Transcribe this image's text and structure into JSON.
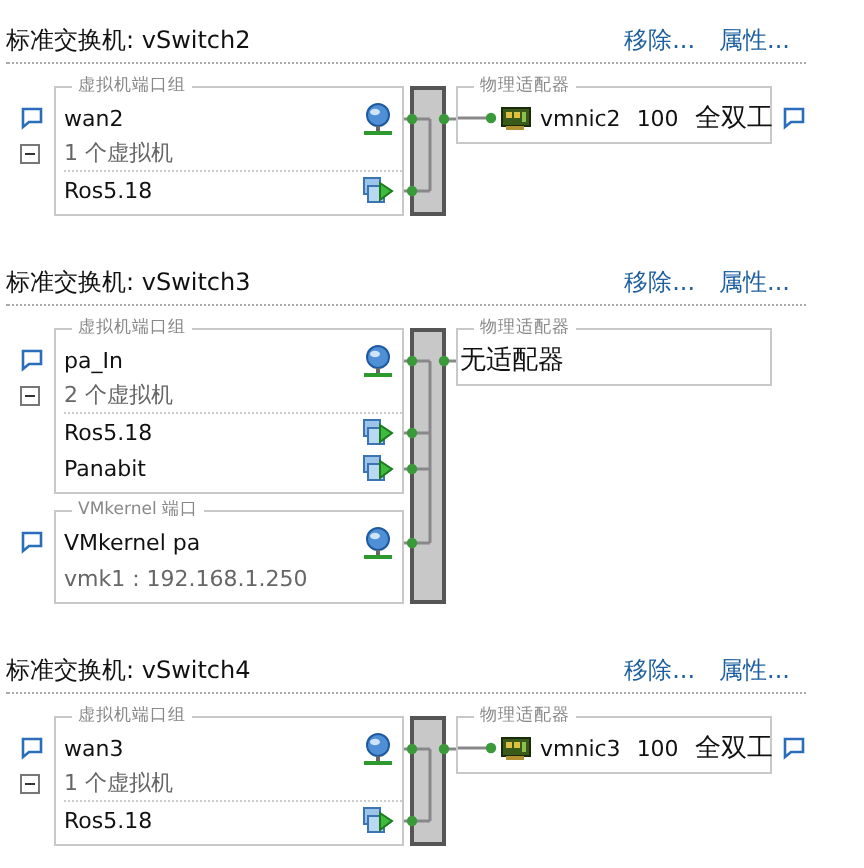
{
  "switches": [
    {
      "title": "标准交换机: vSwitch2",
      "links": [
        "移除...",
        "属性..."
      ],
      "port_groups": [
        {
          "kind": "vm",
          "label": "虚拟机端口组",
          "name": "wan2",
          "vm_count": "1 个虚拟机",
          "expanded": true,
          "vms": [
            "Ros5.18"
          ]
        }
      ],
      "adapter": {
        "label": "物理适配器",
        "nics": [
          {
            "name": "vmnic2",
            "speed": "100",
            "duplex": "全双工"
          }
        ]
      }
    },
    {
      "title": "标准交换机: vSwitch3",
      "links": [
        "移除...",
        "属性..."
      ],
      "port_groups": [
        {
          "kind": "vm",
          "label": "虚拟机端口组",
          "name": "pa_In",
          "vm_count": "2 个虚拟机",
          "expanded": true,
          "vms": [
            "Ros5.18",
            "Panabit"
          ]
        },
        {
          "kind": "vmkernel",
          "label": "VMkernel 端口",
          "name": "VMkernel pa",
          "detail": "vmk1 : 192.168.1.250"
        }
      ],
      "adapter": {
        "label": "物理适配器",
        "empty_text": "无适配器"
      }
    },
    {
      "title": "标准交换机: vSwitch4",
      "links": [
        "移除...",
        "属性..."
      ],
      "port_groups": [
        {
          "kind": "vm",
          "label": "虚拟机端口组",
          "name": "wan3",
          "vm_count": "1 个虚拟机",
          "expanded": true,
          "vms": [
            "Ros5.18"
          ]
        }
      ],
      "adapter": {
        "label": "物理适配器",
        "nics": [
          {
            "name": "vmnic3",
            "speed": "100",
            "duplex": "全双工"
          }
        ]
      }
    }
  ]
}
